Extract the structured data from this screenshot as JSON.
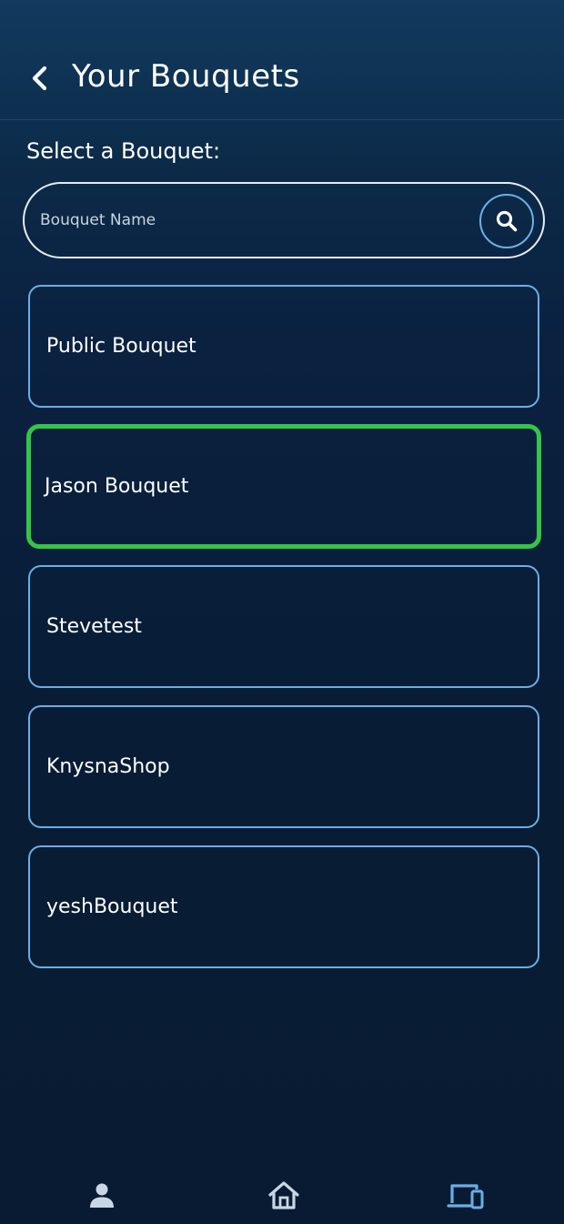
{
  "header": {
    "title": "Your Bouquets",
    "back_icon": "chevron-left-icon"
  },
  "search": {
    "label": "Select a Bouquet:",
    "placeholder": "Bouquet Name",
    "value": "",
    "icon": "search-icon"
  },
  "bouquets": [
    {
      "name": "Public Bouquet",
      "selected": false
    },
    {
      "name": "Jason Bouquet",
      "selected": true
    },
    {
      "name": "Stevetest",
      "selected": false
    },
    {
      "name": "KnysnaShop",
      "selected": false
    },
    {
      "name": "yeshBouquet",
      "selected": false
    }
  ],
  "nav": {
    "items": [
      {
        "icon": "user-icon"
      },
      {
        "icon": "home-icon"
      },
      {
        "icon": "devices-icon",
        "active": true
      }
    ]
  },
  "colors": {
    "accent": "#6aaee6",
    "selected": "#35c448",
    "icon": "#c8d6e6"
  }
}
